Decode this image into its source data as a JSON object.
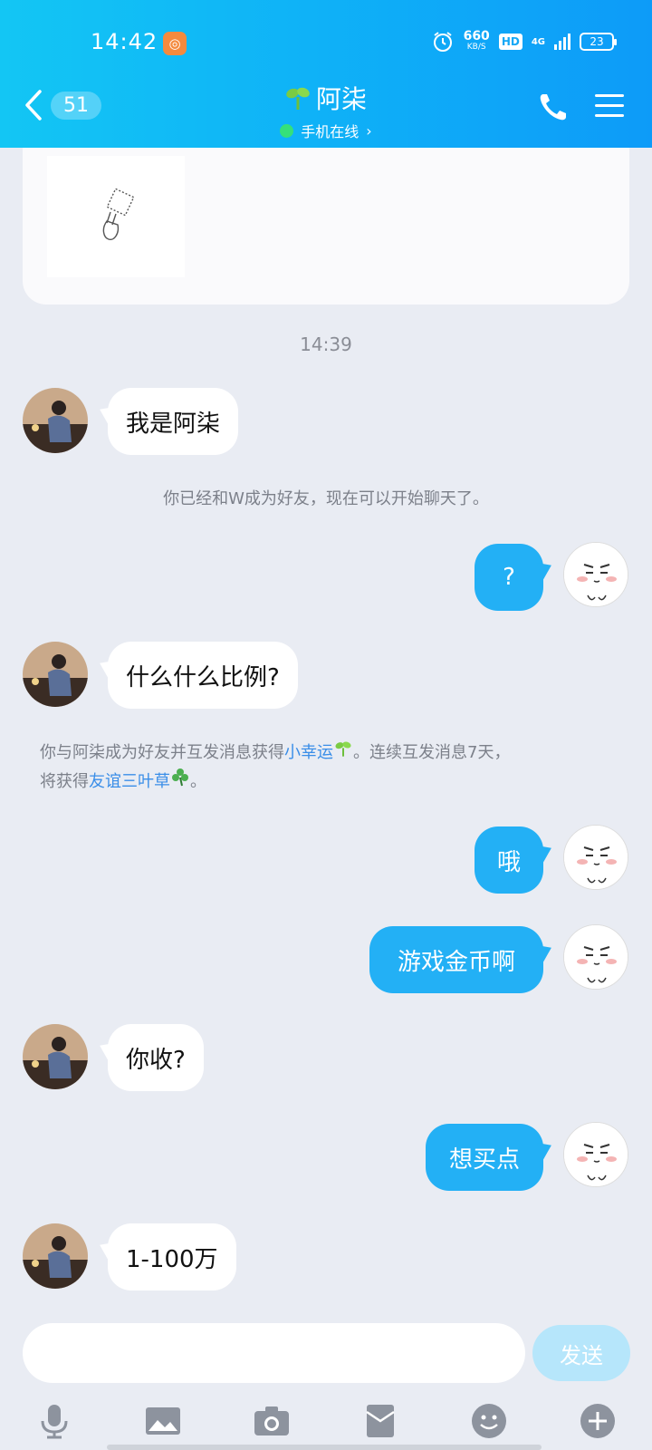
{
  "status_bar": {
    "time": "14:42",
    "net_speed_value": "660",
    "net_speed_unit": "KB/S",
    "hd": "HD",
    "network": "4G",
    "battery": "23"
  },
  "header": {
    "unread_count": "51",
    "title": "阿柒",
    "subtitle": "手机在线",
    "subtitle_chevron": "›"
  },
  "chat": {
    "timestamp": "14:39",
    "messages": [
      {
        "side": "in",
        "text": "我是阿柒"
      },
      {
        "side": "out",
        "text": "?"
      },
      {
        "side": "in",
        "text": "什么什么比例?"
      },
      {
        "side": "out",
        "text": "哦"
      },
      {
        "side": "out",
        "text": "游戏金币啊"
      },
      {
        "side": "in",
        "text": "你收?"
      },
      {
        "side": "out",
        "text": "想买点"
      },
      {
        "side": "in",
        "text": "1-100万"
      }
    ],
    "system_friend": "你已经和W成为好友，现在可以开始聊天了。",
    "system_luck": {
      "part1": "你与阿柒成为好友并互发消息获得",
      "link1": "小幸运",
      "part2": "。连续互发消息7天，",
      "part3": "将获得",
      "link2": "友谊三叶草",
      "part4": "。"
    }
  },
  "input": {
    "placeholder": "",
    "send_label": "发送"
  },
  "colors": {
    "header": "#0fb3f7",
    "bubble_out": "#23b0f5",
    "send_button": "#b6e6fb",
    "link": "#3a8ee8"
  }
}
